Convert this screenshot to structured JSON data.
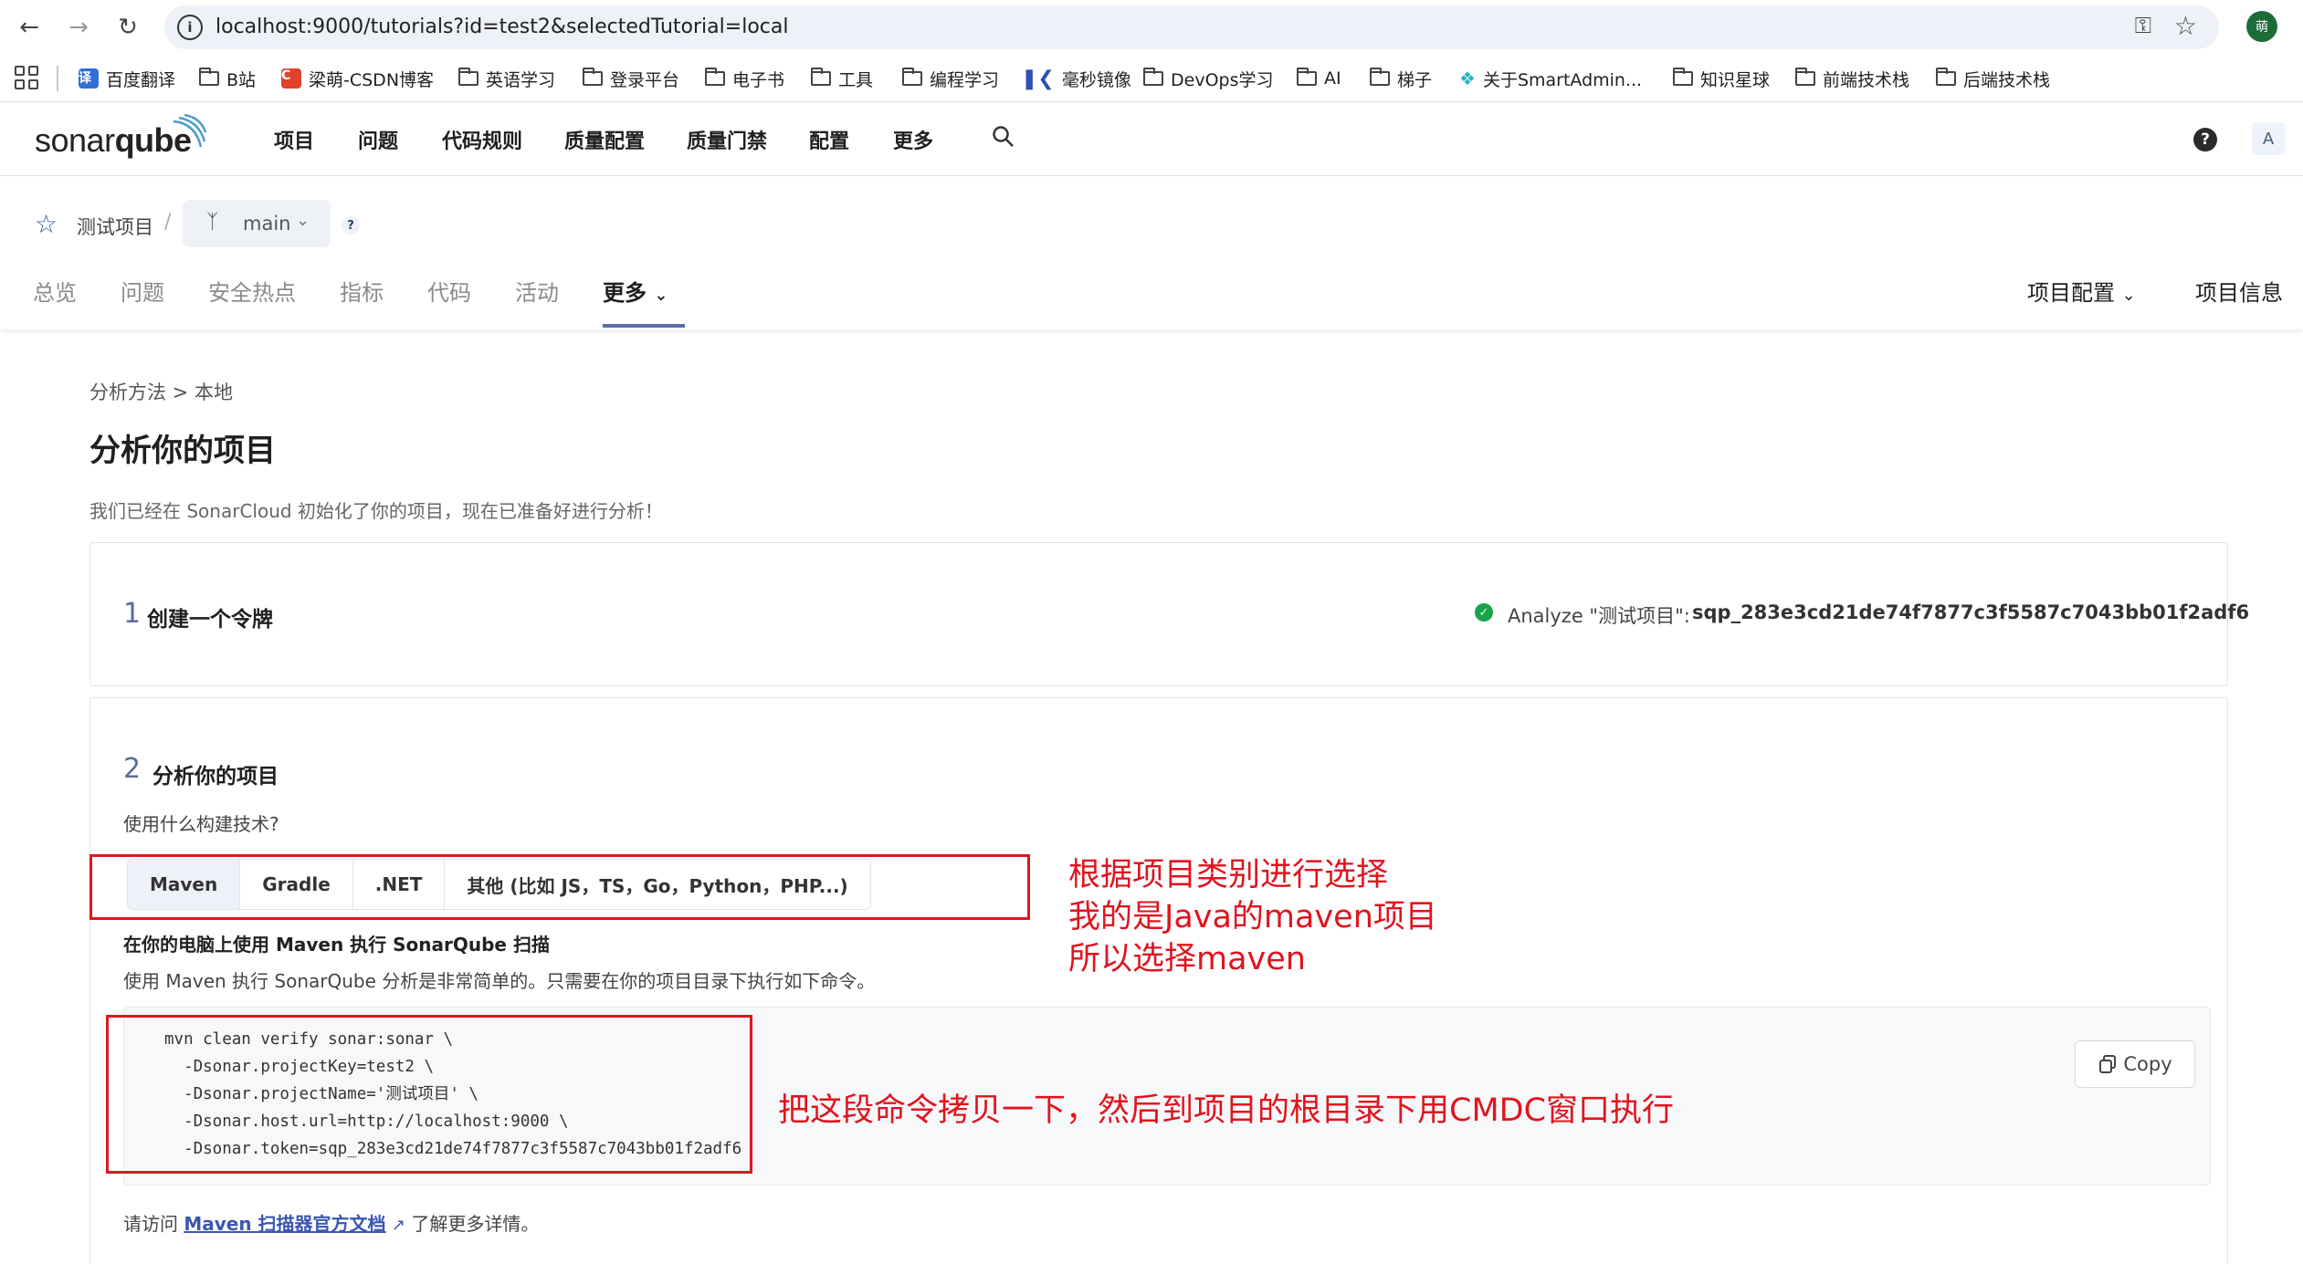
{
  "browser": {
    "url": "localhost:9000/tutorials?id=test2&selectedTutorial=local",
    "profile_initial": "萌"
  },
  "bookmarks": [
    {
      "label": "百度翻译",
      "icon": "baidu-translate-icon"
    },
    {
      "label": "B站",
      "icon": "folder-icon"
    },
    {
      "label": "梁萌-CSDN博客",
      "icon": "csdn-icon"
    },
    {
      "label": "英语学习",
      "icon": "folder-icon"
    },
    {
      "label": "登录平台",
      "icon": "folder-icon"
    },
    {
      "label": "电子书",
      "icon": "folder-icon"
    },
    {
      "label": "工具",
      "icon": "folder-icon"
    },
    {
      "label": "编程学习",
      "icon": "folder-icon"
    },
    {
      "label": "毫秒镜像",
      "icon": "mirror-icon"
    },
    {
      "label": "DevOps学习",
      "icon": "folder-icon"
    },
    {
      "label": "AI",
      "icon": "folder-icon"
    },
    {
      "label": "梯子",
      "icon": "folder-icon"
    },
    {
      "label": "关于SmartAdmin...",
      "icon": "smartadmin-icon"
    },
    {
      "label": "知识星球",
      "icon": "folder-icon"
    },
    {
      "label": "前端技术栈",
      "icon": "folder-icon"
    },
    {
      "label": "后端技术栈",
      "icon": "folder-icon"
    }
  ],
  "header": {
    "logo_text_light": "sonar",
    "logo_text_bold": "qube",
    "nav": [
      "项目",
      "问题",
      "代码规则",
      "质量配置",
      "质量门禁",
      "配置",
      "更多"
    ],
    "user_initial": "A"
  },
  "project": {
    "name": "测试项目",
    "separator": "/",
    "branch": "main",
    "help": "?",
    "tabs": [
      "总览",
      "问题",
      "安全热点",
      "指标",
      "代码",
      "活动",
      "更多"
    ],
    "right_tabs": [
      "项目配置",
      "项目信息"
    ]
  },
  "main": {
    "breadcrumb": "分析方法 > 本地",
    "title": "分析你的项目",
    "subtitle": "我们已经在 SonarCloud 初始化了你的项目，现在已准备好进行分析！",
    "step1": {
      "number": "1",
      "title": "创建一个令牌",
      "token_label": "Analyze \"测试项目\":",
      "token_value": "sqp_283e3cd21de74f7877c3f5587c7043bb01f2adf6"
    },
    "step2": {
      "number": "2",
      "title": "分析你的项目",
      "question": "使用什么构建技术?",
      "options": [
        "Maven",
        "Gradle",
        ".NET",
        "其他 (比如 JS，TS，Go，Python，PHP...)"
      ],
      "selected": "Maven",
      "maven_title": "在你的电脑上使用 Maven 执行 SonarQube 扫描",
      "maven_desc": "使用 Maven 执行 SonarQube 分析是非常简单的。只需要在你的项目目录下执行如下命令。",
      "code_lines": [
        "mvn clean verify sonar:sonar \\",
        "  -Dsonar.projectKey=test2 \\",
        "  -Dsonar.projectName='测试项目' \\",
        "  -Dsonar.host.url=http://localhost:9000 \\",
        "  -Dsonar.token=sqp_283e3cd21de74f7877c3f5587c7043bb01f2adf6"
      ],
      "copy_label": "Copy",
      "docs_prefix": "请访问",
      "docs_link": "Maven 扫描器官方文档",
      "docs_suffix": "了解更多详情。"
    }
  },
  "annotations": {
    "note1_lines": [
      "根据项目类别进行选择",
      "我的是Java的maven项目",
      "所以选择maven"
    ],
    "note2": "把这段命令拷贝一下，然后到项目的根目录下用CMDC窗口执行",
    "color": "#e0141e"
  }
}
